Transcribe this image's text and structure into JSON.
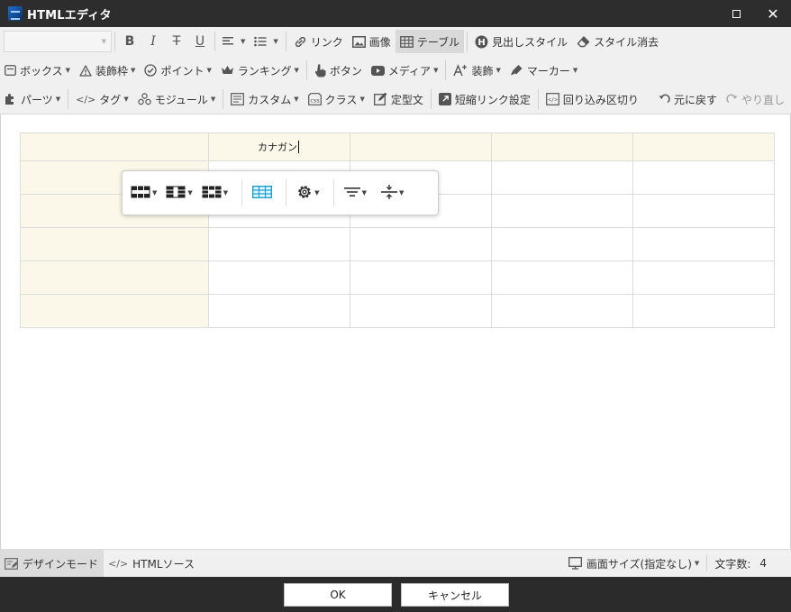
{
  "window": {
    "title": "HTMLエディタ",
    "maximize_icon": "maximize-icon",
    "close_icon": "close-icon"
  },
  "toolbar": {
    "row1": {
      "format_select_value": "",
      "bold": "B",
      "italic": "I",
      "strikethrough": "T",
      "underline": "U",
      "link": "リンク",
      "image": "画像",
      "table": "テーブル",
      "heading_style": "見出しスタイル",
      "clear_style": "スタイル消去"
    },
    "row2": {
      "box": "ボックス",
      "frame": "装飾枠",
      "point": "ポイント",
      "ranking": "ランキング",
      "button": "ボタン",
      "media": "メディア",
      "decoration": "装飾",
      "marker": "マーカー"
    },
    "row3": {
      "parts": "パーツ",
      "tag": "タグ",
      "module": "モジュール",
      "custom": "カスタム",
      "class": "クラス",
      "template": "定型文",
      "short_link": "短縮リンク設定",
      "wrap": "回り込み区切り",
      "undo": "元に戻す",
      "redo": "やり直し"
    }
  },
  "editor": {
    "table": {
      "rows": [
        [
          "",
          "カナガン",
          "",
          "",
          ""
        ],
        [
          "",
          "",
          "",
          "",
          ""
        ],
        [
          "",
          "",
          "",
          "",
          ""
        ],
        [
          "",
          "",
          "",
          "",
          ""
        ],
        [
          "",
          "",
          "",
          "",
          ""
        ],
        [
          "",
          "",
          "",
          "",
          ""
        ]
      ]
    },
    "table_toolbar_icons": [
      "insert-row-icon",
      "insert-column-icon",
      "delete-cells-icon",
      "table-properties-icon",
      "cell-settings-icon",
      "horizontal-align-icon",
      "vertical-align-icon"
    ]
  },
  "statusbar": {
    "design_mode": "デザインモード",
    "html_source": "HTMLソース",
    "screen_size": "画面サイズ(指定なし)",
    "char_count_label": "文字数:",
    "char_count": "4"
  },
  "dialog": {
    "ok": "OK",
    "cancel": "キャンセル"
  },
  "colors": {
    "header_cell_bg": "#fbf8e9",
    "titlebar_bg": "#2d2d2d",
    "toolbar_bg": "#f0f0f0",
    "accent": "#1aa0d8"
  }
}
